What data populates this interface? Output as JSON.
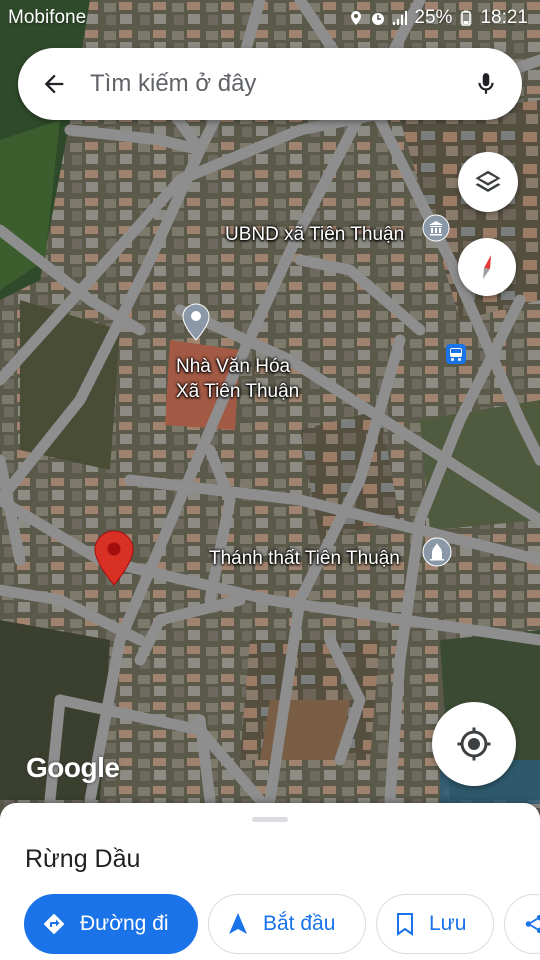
{
  "status_bar": {
    "carrier": "Mobifone",
    "battery": "25%",
    "time": "18:21"
  },
  "search": {
    "placeholder": "Tìm kiếm ở đây"
  },
  "map_labels": {
    "ubnd": "UBND xã Tiên Thuận",
    "nha_van_hoa_line1": "Nhà Văn Hóa",
    "nha_van_hoa_line2": "Xã Tiên Thuận",
    "thanh_that": "Thánh thất Tiên Thuận"
  },
  "attribution": "Google",
  "place": {
    "title": "Rừng Dầu"
  },
  "actions": {
    "directions": "Đường đi",
    "start": "Bắt đầu",
    "save": "Lưu"
  },
  "colors": {
    "accent": "#1a73e8",
    "pin": "#d93025",
    "road": "#8e8e8e"
  },
  "icons": [
    "back-arrow-icon",
    "microphone-icon",
    "layers-icon",
    "compass-icon",
    "my-location-icon",
    "directions-icon",
    "navigation-arrow-icon",
    "bookmark-icon",
    "share-icon"
  ]
}
